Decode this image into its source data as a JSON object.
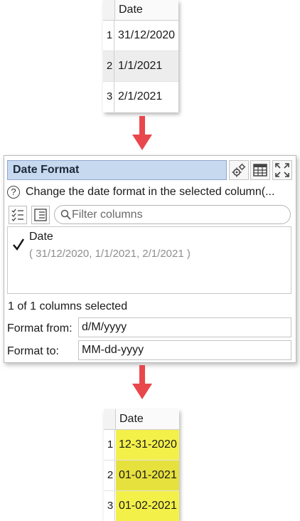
{
  "input_table": {
    "header": "Date",
    "rows": [
      {
        "num": "1",
        "value": "31/12/2020"
      },
      {
        "num": "2",
        "value": "1/1/2021"
      },
      {
        "num": "3",
        "value": "2/1/2021"
      }
    ]
  },
  "panel": {
    "title": "Date Format",
    "help_text": "Change the date format in the selected column(...",
    "filter_placeholder": "Filter columns",
    "columns": [
      {
        "name": "Date",
        "sample": "( 31/12/2020, 1/1/2021, 2/1/2021 )",
        "checked": true
      }
    ],
    "selected_count": "1 of 1 columns selected",
    "format_from_label": "Format from:",
    "format_from_value": "d/M/yyyy",
    "format_to_label": "Format to:",
    "format_to_value": "MM-dd-yyyy"
  },
  "output_table": {
    "header": "Date",
    "highlight_color": "#f4f04a",
    "rows": [
      {
        "num": "1",
        "value": "12-31-2020"
      },
      {
        "num": "2",
        "value": "01-01-2021"
      },
      {
        "num": "3",
        "value": "01-02-2021"
      }
    ]
  },
  "colors": {
    "arrow": "#e8474c",
    "title_bar": "#c7d9ef"
  },
  "icons": [
    "gears-icon",
    "table-icon",
    "maximize-icon",
    "help-icon",
    "select-all-icon",
    "deselect-all-icon",
    "search-icon",
    "checkmark-icon",
    "down-arrow-icon"
  ]
}
